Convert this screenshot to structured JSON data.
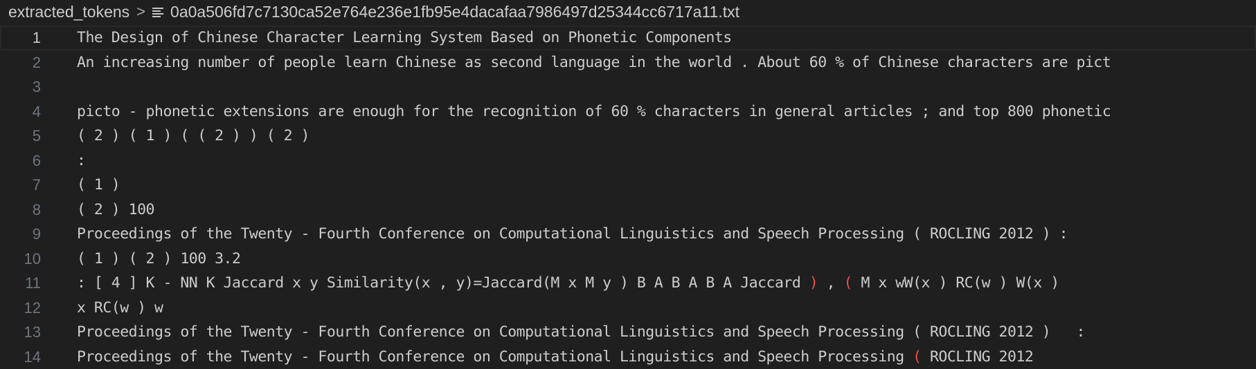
{
  "breadcrumb": {
    "folder": "extracted_tokens",
    "separator": ">",
    "file_icon": "lines-icon",
    "file": "0a0a506fd7c7130ca52e764e236e1fb95e4dacafaa7986497d25344cc6717a11.txt"
  },
  "editor": {
    "current_line": 1,
    "accent_bracket_color": "#f14c4c",
    "lines": [
      {
        "number": "1",
        "text": "The Design of Chinese Character Learning System Based on Phonetic Components"
      },
      {
        "number": "2",
        "text": "An increasing number of people learn Chinese as second language in the world . About 60 % of Chinese characters are pict"
      },
      {
        "number": "3",
        "text": ""
      },
      {
        "number": "4",
        "text": "picto - phonetic extensions are enough for the recognition of 60 % characters in general articles ; and top 800 phonetic"
      },
      {
        "number": "5",
        "text": "( 2 ) ( 1 ) ( ( 2 ) ) ( 2 )"
      },
      {
        "number": "6",
        "text": ":"
      },
      {
        "number": "7",
        "text": "( 1 )"
      },
      {
        "number": "8",
        "text": "( 2 ) 100"
      },
      {
        "number": "9",
        "text": "Proceedings of the Twenty - Fourth Conference on Computational Linguistics and Speech Processing ( ROCLING 2012 ) :"
      },
      {
        "number": "10",
        "text": "( 1 ) ( 2 ) 100 3.2"
      },
      {
        "number": "11",
        "text_a": ": [ 4 ] K - NN K Jaccard x y Similarity(x , y)=Jaccard(M x M y ) B A B A B A Jaccard ",
        "red_a": ")",
        "text_b": " , ",
        "red_b": "(",
        "text_c": " M x wW(x ) RC(w ) W(x )"
      },
      {
        "number": "12",
        "text": "x RC(w ) w"
      },
      {
        "number": "13",
        "text": "Proceedings of the Twenty - Fourth Conference on Computational Linguistics and Speech Processing ( ROCLING 2012 )   :"
      },
      {
        "number": "14",
        "text_a": "Proceedings of the Twenty - Fourth Conference on Computational Linguistics and Speech Processing ",
        "red_a": "(",
        "text_b": " ROCLING 2012"
      }
    ]
  }
}
